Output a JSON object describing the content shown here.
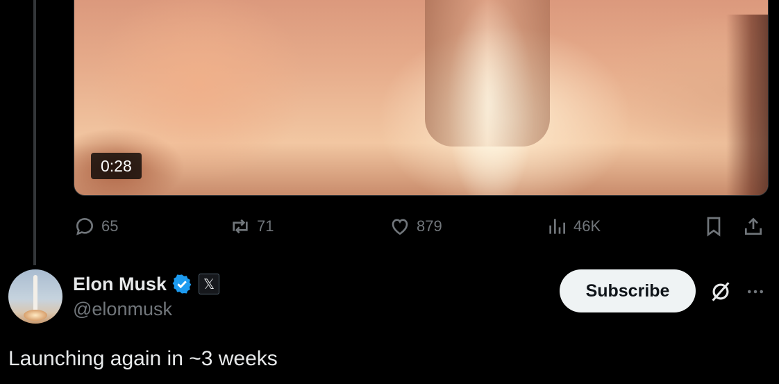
{
  "media": {
    "duration": "0:28"
  },
  "actions": {
    "replies": {
      "icon": "reply-icon",
      "count": "65"
    },
    "reposts": {
      "icon": "repost-icon",
      "count": "71"
    },
    "likes": {
      "icon": "like-icon",
      "count": "879"
    },
    "views": {
      "icon": "views-icon",
      "count": "46K"
    },
    "bookmark": {
      "icon": "bookmark-icon"
    },
    "share": {
      "icon": "share-icon"
    }
  },
  "author": {
    "display_name": "Elon Musk",
    "handle": "@elonmusk",
    "verified": true,
    "affiliate_badge": "𝕏",
    "subscribe_label": "Subscribe"
  },
  "tweet": {
    "text": "Launching again in ~3 weeks"
  },
  "colors": {
    "background": "#000000",
    "text_primary": "#e7e9ea",
    "text_secondary": "#71767b",
    "verified_blue": "#1d9bf0",
    "subscribe_bg": "#eff3f4"
  }
}
